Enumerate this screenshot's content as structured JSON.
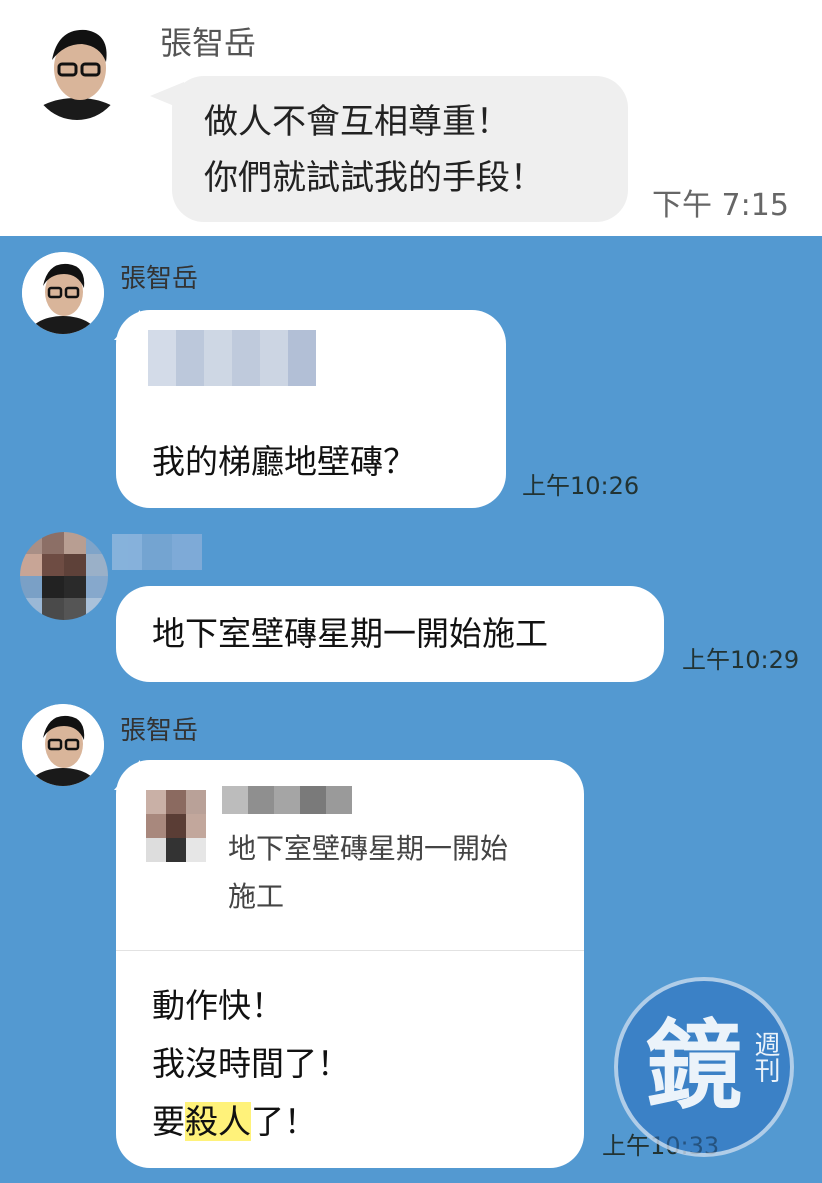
{
  "colors": {
    "chat_background": "#5399d1",
    "top_background": "#ffffff",
    "bubble": "#ffffff",
    "top_bubble": "#efefef",
    "highlight": "#fff27a"
  },
  "top_message": {
    "sender": "張智岳",
    "lines": [
      "做人不會互相尊重！",
      "你們就試試我的手段！"
    ],
    "time": "下午 7:15"
  },
  "messages": [
    {
      "sender": "張智岳",
      "text": "我的梯廳地壁磚？",
      "time": "上午10:26",
      "has_blurred_quote": true
    },
    {
      "sender": "",
      "text": "地下室壁磚星期一開始施工",
      "time": "上午10:29",
      "sender_blurred": true
    },
    {
      "sender": "張智岳",
      "quote_lines": [
        "地下室壁磚星期一開始",
        "施工"
      ],
      "lines_plain": [
        "動作快！",
        "我沒時間了！"
      ],
      "last_line_prefix": "要",
      "last_line_highlight": "殺人",
      "last_line_suffix": "了！",
      "time": "上午10:33"
    }
  ],
  "watermark": {
    "main": "鏡",
    "side": "週刊"
  }
}
